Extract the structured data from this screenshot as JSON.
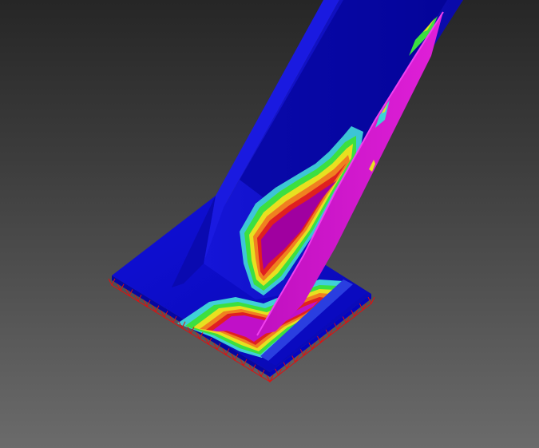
{
  "viewport": {
    "kind": "3D FEA stress contour view",
    "background_top": "#262626",
    "background_bottom": "#6b6b6b"
  },
  "model": {
    "parts": [
      "inclined-beam",
      "gusset-plate",
      "base-plate",
      "fixed-support-constraints"
    ],
    "contour_colors": {
      "low": "#0000c8",
      "low_dark": "#0a0aa0",
      "cyan": "#3fd0d8",
      "green": "#3ce040",
      "yellow": "#e8e020",
      "orange": "#f08020",
      "red": "#e02020",
      "purple": "#a000a0",
      "magenta": "#d010c8"
    },
    "constraint_color": "#e01010"
  }
}
